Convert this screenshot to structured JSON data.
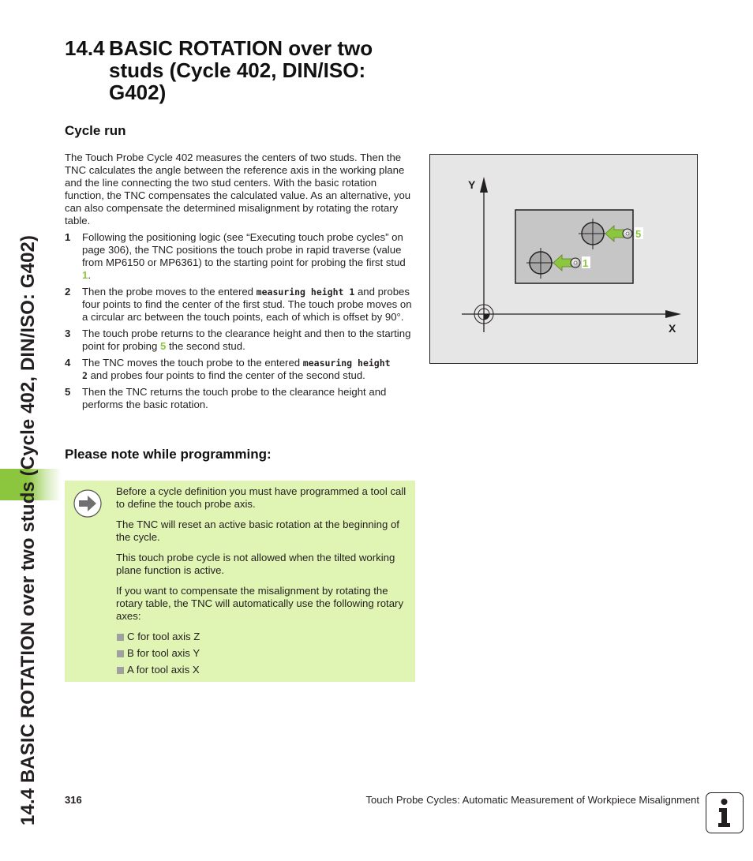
{
  "side_title": "14.4 BASIC ROTATION over two studs (Cycle 402, DIN/ISO: G402)",
  "title": {
    "number": "14.4",
    "text": "BASIC ROTATION over two studs (Cycle 402, DIN/ISO: G402)"
  },
  "cycle_run": {
    "heading": "Cycle run",
    "intro": "The Touch Probe Cycle 402 measures the centers of two studs. Then the TNC calculates the angle between the reference axis in the working plane and the line connecting the two stud centers. With the basic rotation function, the TNC compensates the calculated value. As an alternative, you can also compensate the determined misalignment by rotating the rotary table.",
    "steps": [
      {
        "n": "1",
        "a": "Following the positioning logic (see “Executing touch probe cycles” on page 306), the TNC positions the touch probe in rapid traverse (value from MP6150 or MP6361) to the starting point for probing the first stud ",
        "hl": "1",
        "b": "."
      },
      {
        "n": "2",
        "a": "Then the probe moves to the entered ",
        "code": "measuring height 1",
        "b": " and probes four points to find the center of the first stud. The touch probe moves on a circular arc between the touch points, each of which is offset by 90°."
      },
      {
        "n": "3",
        "a": "The touch probe returns to the clearance height and then to the starting point for probing ",
        "hl": "5",
        "b": " the second stud."
      },
      {
        "n": "4",
        "a": "The TNC moves the touch probe to the entered ",
        "code": "measuring height",
        "code2": "2",
        "b": " and probes four points to find the center of the second stud."
      },
      {
        "n": "5",
        "a": "Then the TNC returns the touch probe to the clearance height and performs the basic rotation."
      }
    ]
  },
  "figure": {
    "axis_y": "Y",
    "axis_x": "X",
    "label_stud1": "1",
    "label_stud2": "5"
  },
  "note": {
    "heading": "Please note while programming:",
    "icon": "arrow-right-icon",
    "paragraphs": [
      "Before a cycle definition you must have programmed a tool call to define the touch probe axis.",
      "The TNC will reset an active basic rotation at the beginning of the cycle.",
      "This touch probe cycle is not allowed when the tilted working plane function is active.",
      "If you want to compensate the misalignment by rotating the rotary table, the TNC will automatically use the following rotary axes:"
    ],
    "bullets": [
      "C for tool axis Z",
      "B for tool axis Y",
      "A for tool axis X"
    ]
  },
  "footer": {
    "page": "316",
    "chapter": "Touch Probe Cycles: Automatic Measurement of Workpiece Misalignment",
    "icon": "info-icon"
  },
  "colors": {
    "accent_green": "#8cc63f",
    "note_bg": "#e0f5b3",
    "figure_bg": "#e6e6e6"
  }
}
